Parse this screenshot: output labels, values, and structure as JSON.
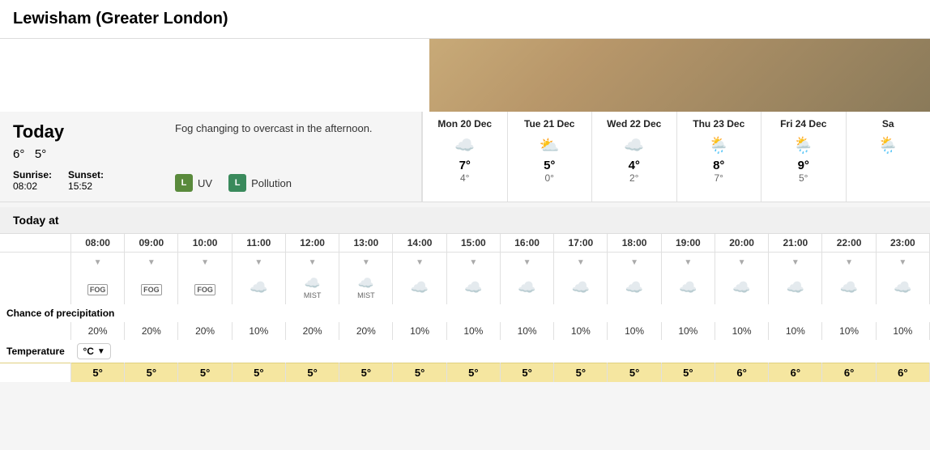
{
  "title": "Lewisham (Greater London)",
  "today": {
    "label": "Today",
    "high": "6°",
    "low": "5°",
    "sunrise_label": "Sunrise:",
    "sunrise": "08:02",
    "sunset_label": "Sunset:",
    "sunset": "15:52",
    "description": "Fog changing to overcast in the afternoon.",
    "uv_label": "UV",
    "uv_level": "L",
    "pollution_label": "Pollution",
    "pollution_level": "L"
  },
  "forecast": [
    {
      "day": "Mon 20 Dec",
      "high": "7°",
      "low": "4°",
      "icon": "cloud"
    },
    {
      "day": "Tue 21 Dec",
      "high": "5°",
      "low": "0°",
      "icon": "sun_cloud"
    },
    {
      "day": "Wed 22 Dec",
      "high": "4°",
      "low": "2°",
      "icon": "cloud"
    },
    {
      "day": "Thu 23 Dec",
      "high": "8°",
      "low": "7°",
      "icon": "rain_cloud"
    },
    {
      "day": "Fri 24 Dec",
      "high": "9°",
      "low": "5°",
      "icon": "rain_cloud"
    },
    {
      "day": "Sa",
      "high": "",
      "low": "",
      "icon": "rain_cloud"
    }
  ],
  "hourly": {
    "label": "Today at",
    "times": [
      "08:00",
      "09:00",
      "10:00",
      "11:00",
      "12:00",
      "13:00",
      "14:00",
      "15:00",
      "16:00",
      "17:00",
      "18:00",
      "19:00",
      "20:00",
      "21:00",
      "22:00",
      "23:00"
    ],
    "icons": [
      "fog",
      "fog",
      "fog",
      "cloud",
      "mist",
      "mist",
      "cloud",
      "cloud",
      "cloud",
      "cloud",
      "cloud",
      "cloud",
      "cloud",
      "cloud",
      "cloud",
      "cloud"
    ],
    "precipitation": [
      "20%",
      "20%",
      "20%",
      "10%",
      "20%",
      "20%",
      "10%",
      "10%",
      "10%",
      "10%",
      "10%",
      "10%",
      "10%",
      "10%",
      "10%",
      "10%"
    ],
    "temperatures": [
      "5°",
      "5°",
      "5°",
      "5°",
      "5°",
      "5°",
      "5°",
      "5°",
      "5°",
      "5°",
      "5°",
      "5°",
      "6°",
      "6°",
      "6°",
      "6°"
    ],
    "temp_unit": "°C"
  }
}
